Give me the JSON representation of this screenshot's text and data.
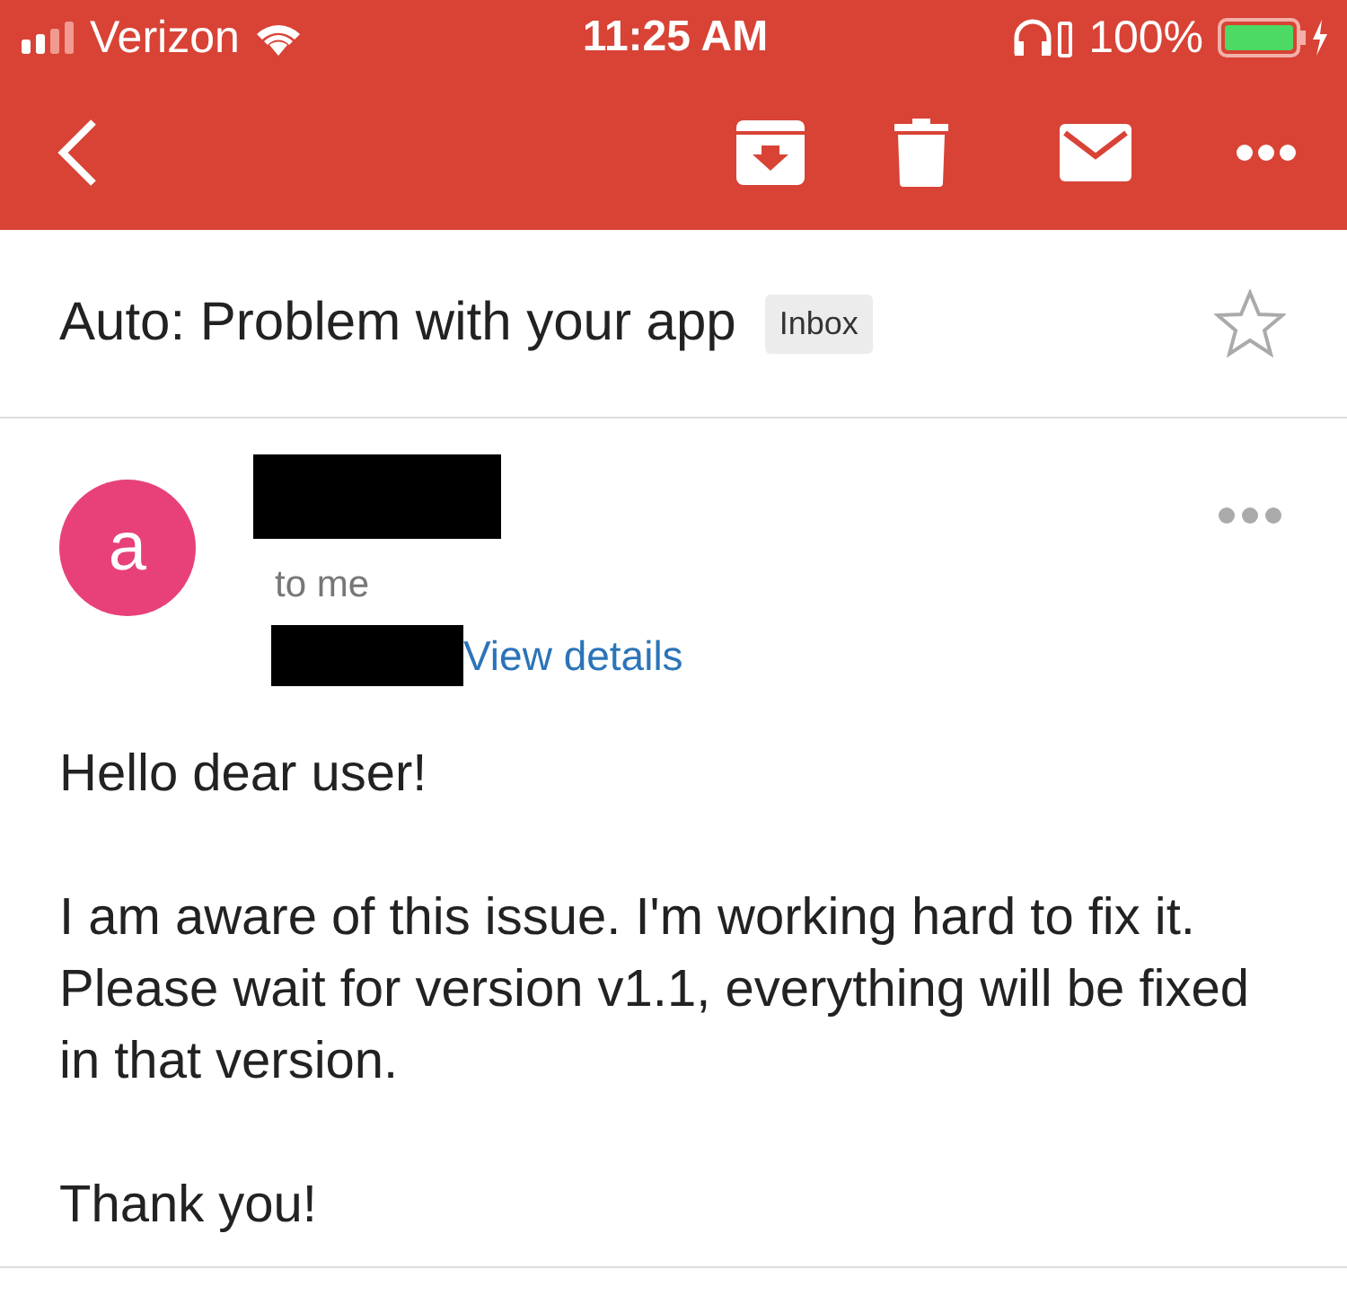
{
  "status_bar": {
    "carrier": "Verizon",
    "time": "11:25 AM",
    "battery": "100%"
  },
  "subject": {
    "title": "Auto: Problem with your app",
    "label": "Inbox",
    "starred": false
  },
  "sender": {
    "avatar_letter": "a",
    "recipient": "to me",
    "details_link": "View details"
  },
  "body": [
    "Hello dear user!",
    "I am aware of this issue. I'm working hard to fix it. Please wait for version v1.1, everything will be fixed in that version.",
    "Thank you!"
  ]
}
